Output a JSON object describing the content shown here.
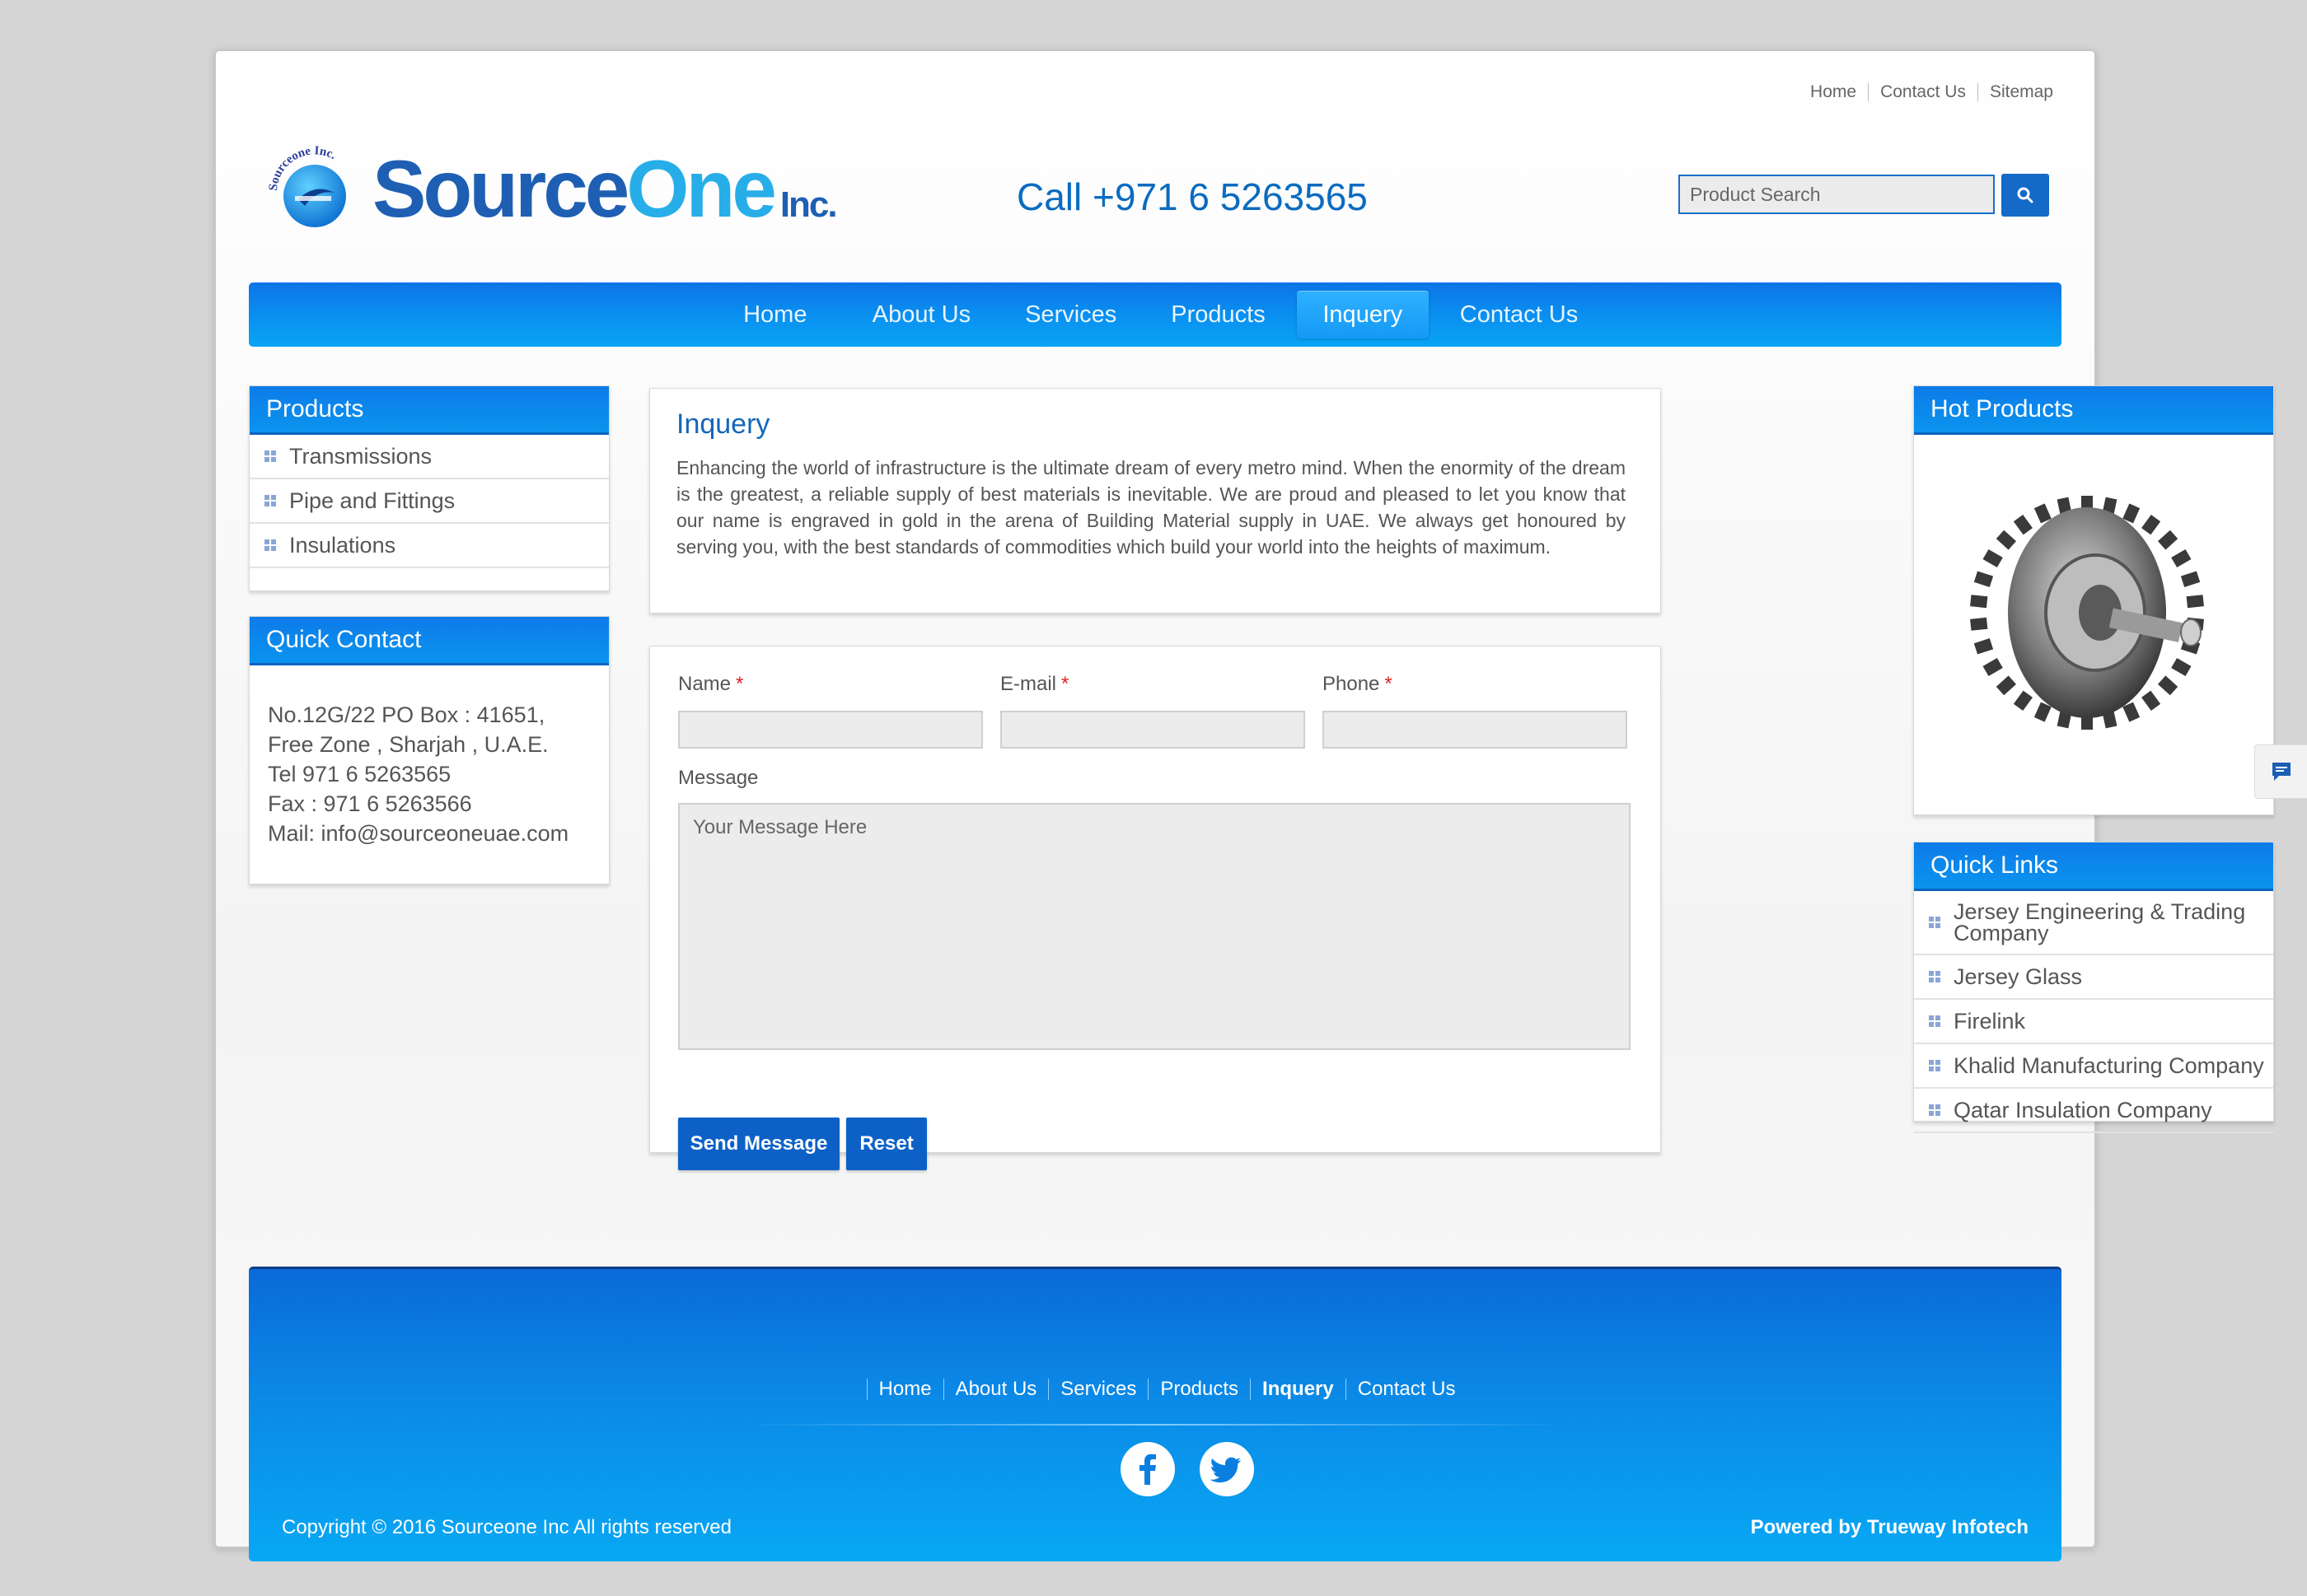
{
  "top_links": [
    "Home",
    "Contact Us",
    "Sitemap"
  ],
  "logo": {
    "word1": "Source",
    "word2": "One",
    "suffix": "Inc.",
    "badge_text": "Sourceone Inc."
  },
  "call": "Call +971 6 5263565",
  "search": {
    "placeholder": "Product Search",
    "icon": "search-icon"
  },
  "nav": {
    "items": [
      "Home",
      "About Us",
      "Services",
      "Products",
      "Inquery",
      "Contact Us"
    ],
    "active": "Inquery"
  },
  "products_box": {
    "title": "Products",
    "items": [
      "Transmissions",
      "Pipe and Fittings",
      "Insulations"
    ]
  },
  "quick_contact": {
    "title": "Quick Contact",
    "lines": [
      "No.12G/22 PO Box : 41651,",
      "Free Zone , Sharjah , U.A.E.",
      "Tel 971 6 5263565",
      "Fax : 971 6 5263566",
      "Mail: info@sourceoneuae.com"
    ]
  },
  "intro": {
    "title": "Inquery",
    "text": "Enhancing the world of infrastructure is the ultimate dream of every metro mind. When the enormity of the dream is the greatest, a reliable supply of best materials is inevitable. We are proud and pleased to let you know that our name is engraved in gold in the arena of Building Material supply in UAE. We always get honoured by serving you, with the best standards of commodities which build your world into the heights of maximum."
  },
  "form": {
    "name_label": "Name",
    "email_label": "E-mail",
    "phone_label": "Phone",
    "required_mark": "*",
    "message_label": "Message",
    "message_placeholder": "Your Message Here",
    "send_label": "Send Message",
    "reset_label": "Reset"
  },
  "hot_products": {
    "title": "Hot Products",
    "image": "sprocket-gear-image"
  },
  "quick_links": {
    "title": "Quick Links",
    "items": [
      "Jersey Engineering & Trading Company",
      "Jersey Glass",
      "Firelink",
      "Khalid Manufacturing Company",
      "Qatar Insulation Company"
    ]
  },
  "footer": {
    "nav": [
      "Home",
      "About Us",
      "Services",
      "Products",
      "Inquery",
      "Contact Us"
    ],
    "social": [
      "facebook-icon",
      "twitter-icon"
    ],
    "copyright": "Copyright © 2016 Sourceone Inc All rights reserved",
    "powered_prefix": "Powered by",
    "powered_by": "Trueway Infotech"
  },
  "colors": {
    "brand_blue": "#0a8ff0",
    "accent_dark": "#0d61c6",
    "required": "#e02020"
  }
}
